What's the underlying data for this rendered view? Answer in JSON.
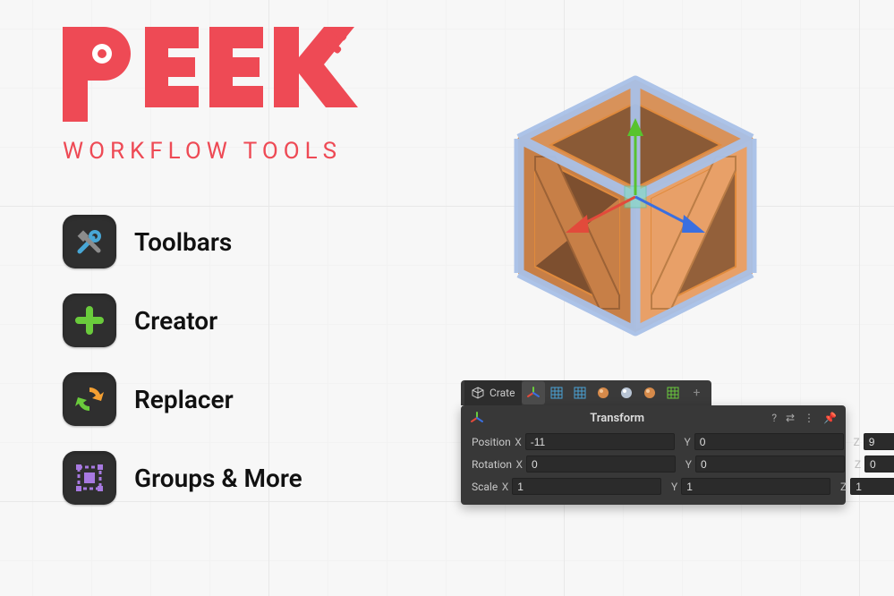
{
  "brand": {
    "name": "PEEK",
    "subtitle": "WORKFLOW  TOOLS",
    "color": "#ee4a55"
  },
  "features": [
    {
      "id": "toolbars",
      "label": "Toolbars"
    },
    {
      "id": "creator",
      "label": "Creator"
    },
    {
      "id": "replacer",
      "label": "Replacer"
    },
    {
      "id": "groups",
      "label": "Groups & More"
    }
  ],
  "object_tab": {
    "name": "Crate"
  },
  "transform_panel": {
    "title": "Transform",
    "rows": [
      {
        "label": "Position",
        "x": "-11",
        "y": "0",
        "z": "9"
      },
      {
        "label": "Rotation",
        "x": "0",
        "y": "0",
        "z": "0"
      },
      {
        "label": "Scale",
        "x": "1",
        "y": "1",
        "z": "1"
      }
    ],
    "axis_labels": {
      "x": "X",
      "y": "Y",
      "z": "Z"
    }
  },
  "colors": {
    "green": "#6acb3c",
    "purple": "#a779e0",
    "blue": "#3aa6d8",
    "orange": "#e09a55",
    "panel": "#383838"
  }
}
